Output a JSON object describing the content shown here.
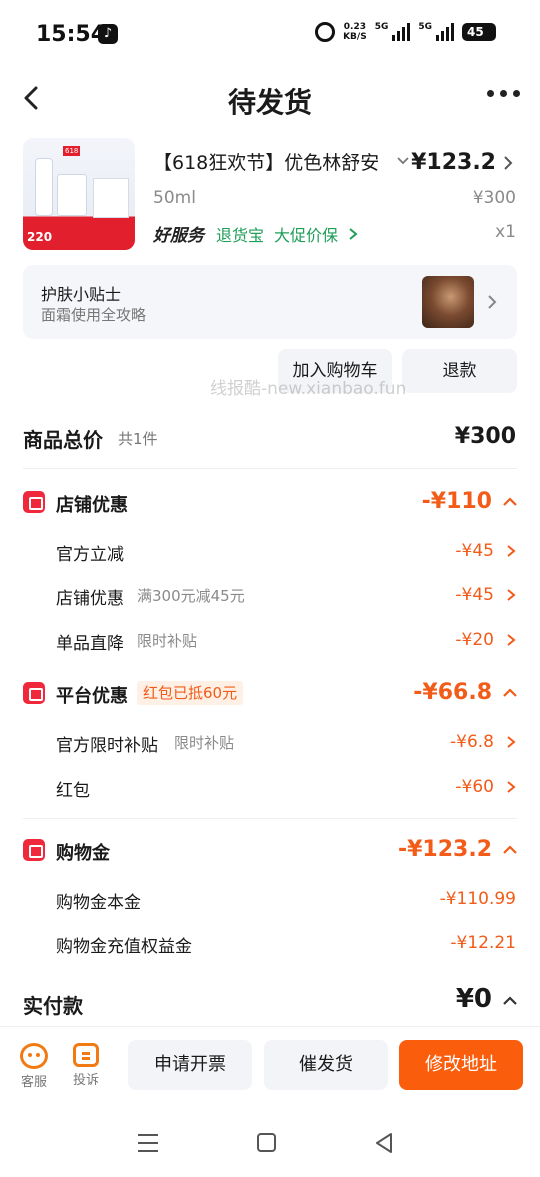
{
  "status_bar": {
    "time": "15:54",
    "net_speed_value": "0.23",
    "net_speed_unit": "KB/S",
    "sim1": "5G",
    "sim2": "5G",
    "battery": "45"
  },
  "header": {
    "title": "待发货"
  },
  "product": {
    "title": "【618狂欢节】优色林舒安",
    "price": "¥123.2",
    "spec": "50ml",
    "original_price": "¥300",
    "quantity": "x1",
    "service_brand": "好服务",
    "service_items": [
      "退货宝",
      "大促价保"
    ],
    "thumb_price": "220"
  },
  "tip": {
    "title": "护肤小贴士",
    "subtitle": "面霜使用全攻略"
  },
  "actions": {
    "add_cart": "加入购物车",
    "refund": "退款"
  },
  "watermark": "线报酷-new.xianbao.fun",
  "totals": {
    "label": "商品总价",
    "count": "共1件",
    "value": "¥300"
  },
  "store_discount": {
    "title": "店铺优惠",
    "amount": "-¥110",
    "rows": [
      {
        "label": "官方立减",
        "note": "",
        "amount": "-¥45"
      },
      {
        "label": "店铺优惠",
        "note": "满300元减45元",
        "amount": "-¥45"
      },
      {
        "label": "单品直降",
        "note": "限时补贴",
        "amount": "-¥20"
      }
    ]
  },
  "platform_discount": {
    "title": "平台优惠",
    "badge": "红包已抵60元",
    "amount": "-¥66.8",
    "rows": [
      {
        "label": "官方限时补贴",
        "note": "限时补贴",
        "amount": "-¥6.8"
      },
      {
        "label": "红包",
        "note": "",
        "amount": "-¥60"
      }
    ]
  },
  "shopping_gold": {
    "title": "购物金",
    "amount": "-¥123.2",
    "rows": [
      {
        "label": "购物金本金",
        "amount": "-¥110.99"
      },
      {
        "label": "购物金充值权益金",
        "amount": "-¥12.21"
      }
    ]
  },
  "payment": {
    "label": "实付款",
    "value": "¥0"
  },
  "bottom_bar": {
    "service_label": "客服",
    "complaint_label": "投诉",
    "invoice_button": "申请开票",
    "urge_button": "催发货",
    "address_button": "修改地址"
  },
  "colors": {
    "accent_orange": "#fa5d0c",
    "discount_orange": "#f25b18",
    "service_green": "#1f9e58",
    "icon_red": "#f0283c"
  }
}
